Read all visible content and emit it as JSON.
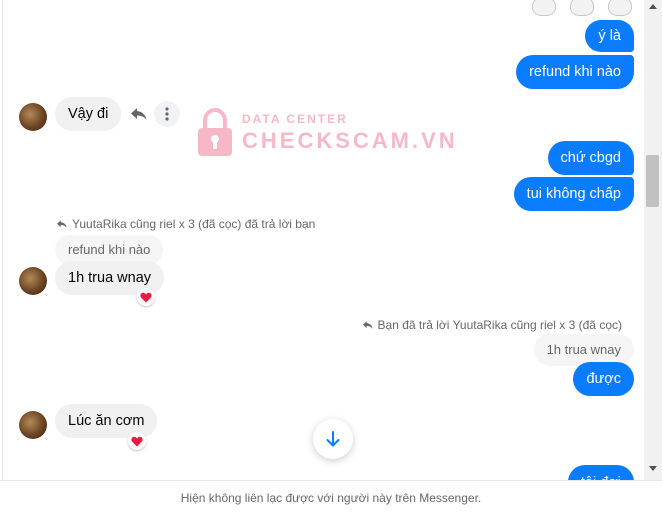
{
  "messages": {
    "y_la": "ý là",
    "refund": "refund khi nào",
    "vay_di": "Vậy đi",
    "chu_cbgd": "chứ cbgd",
    "tui_khong_chap": "tui không chấp",
    "reply1_info": "YuutaRika cũng riel x 3 (đã cọc) đã trả lời bạn",
    "reply1_quoted": "refund khi nào",
    "reply1_text": "1h trua wnay",
    "reply2_info": "Bạn đã trả lời YuutaRika cũng riel x 3 (đã cọc)",
    "reply2_quoted": "1h trua wnay",
    "reply2_text": "được",
    "luc_an_com": "Lúc ăn cơm",
    "partial": "tôi đợi"
  },
  "watermark": {
    "line1": "DATA CENTER",
    "line2": "CHECKSCAM.VN"
  },
  "footer": {
    "notice": "Hiện không liên lạc được với người này trên Messenger."
  },
  "icons": {
    "reply": "reply-arrow-icon",
    "more": "more-dots-icon",
    "heart": "heart-icon",
    "scroll_down": "arrow-down-icon"
  },
  "colors": {
    "outgoing": "#0a7cff",
    "incoming": "#f0f0f0",
    "heart": "#e41e3f",
    "watermark": "#f07f9a"
  }
}
